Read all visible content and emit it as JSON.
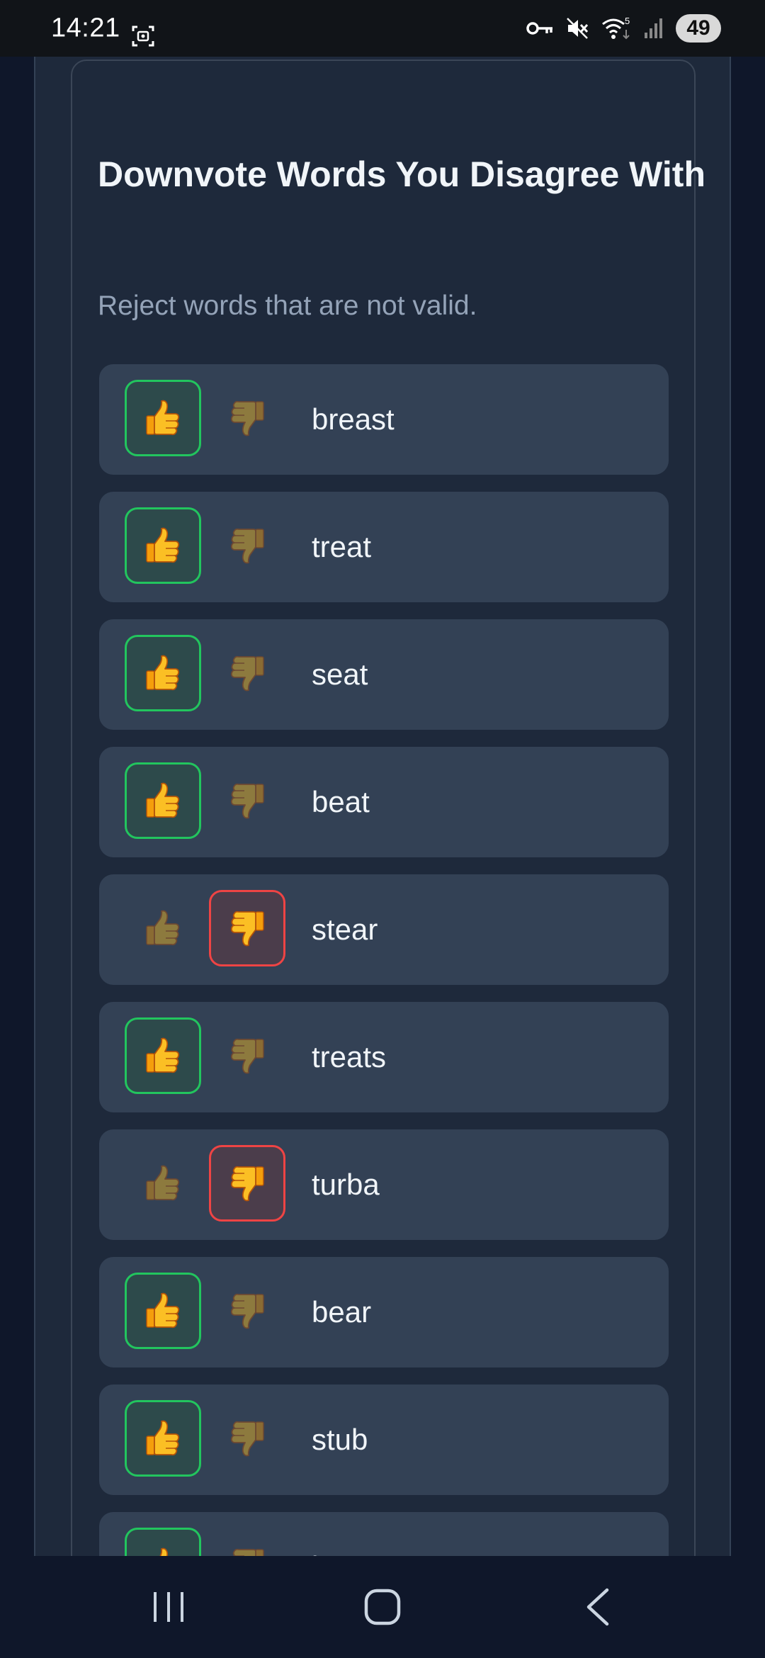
{
  "status_bar": {
    "time": "14:21",
    "battery": "49",
    "wifi_label": "5",
    "icons": [
      "screenshot-icon",
      "key-icon",
      "mute-icon",
      "wifi-icon",
      "signal-icon",
      "battery-icon"
    ]
  },
  "card": {
    "title": "Downvote Words You Disagree With",
    "subtitle": "Reject words that are not valid."
  },
  "colors": {
    "approve": "#22c55e",
    "reject": "#ef4444",
    "row_bg": "#334155",
    "card_bg": "#1e293b",
    "page_bg": "#0f172a"
  },
  "words": [
    {
      "word": "breast",
      "vote": "up"
    },
    {
      "word": "treat",
      "vote": "up"
    },
    {
      "word": "seat",
      "vote": "up"
    },
    {
      "word": "beat",
      "vote": "up"
    },
    {
      "word": "stear",
      "vote": "down"
    },
    {
      "word": "treats",
      "vote": "up"
    },
    {
      "word": "turba",
      "vote": "down"
    },
    {
      "word": "bear",
      "vote": "up"
    },
    {
      "word": "stub",
      "vote": "up"
    },
    {
      "word": "bust",
      "vote": "up"
    }
  ],
  "nav_bar": {
    "icons": [
      "recent-apps-icon",
      "home-icon",
      "back-icon"
    ]
  }
}
